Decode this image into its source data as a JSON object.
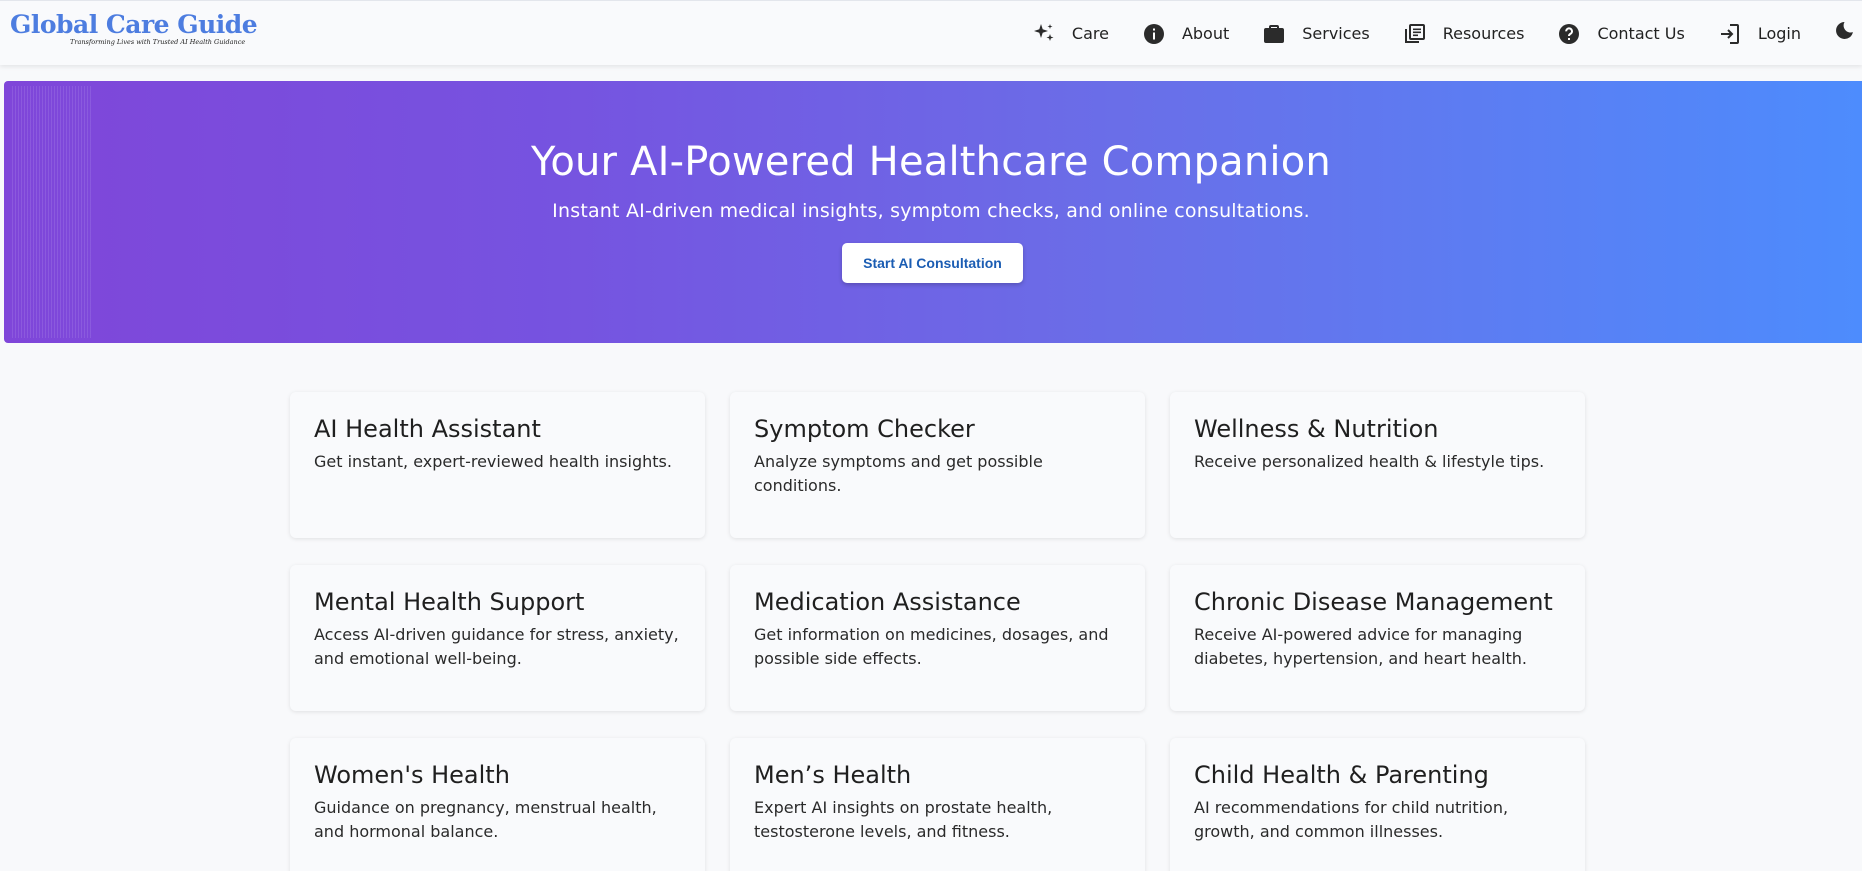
{
  "brand": {
    "name": "Global Care Guide",
    "tagline": "Transforming Lives with Trusted AI Health Guidance",
    "color": "#4d7de0"
  },
  "nav": {
    "items": [
      {
        "label": "Care",
        "icon": "sparkle-icon"
      },
      {
        "label": "About",
        "icon": "info-icon"
      },
      {
        "label": "Services",
        "icon": "briefcase-icon"
      },
      {
        "label": "Resources",
        "icon": "library-books-icon"
      },
      {
        "label": "Contact Us",
        "icon": "help-icon"
      },
      {
        "label": "Login",
        "icon": "login-icon"
      }
    ],
    "theme_toggle_icon": "moon-icon"
  },
  "hero": {
    "title": "Your AI-Powered Healthcare Companion",
    "subtitle": "Instant AI-driven medical insights, symptom checks, and online consultations.",
    "cta_label": "Start AI Consultation",
    "gradient_start": "#7f46d9",
    "gradient_end": "#4d8cfd"
  },
  "cards": [
    {
      "title": "AI Health Assistant",
      "description": "Get instant, expert-reviewed health insights."
    },
    {
      "title": "Symptom Checker",
      "description": "Analyze symptoms and get possible conditions."
    },
    {
      "title": "Wellness & Nutrition",
      "description": "Receive personalized health & lifestyle tips."
    },
    {
      "title": "Mental Health Support",
      "description": "Access AI-driven guidance for stress, anxiety, and emotional well-being."
    },
    {
      "title": "Medication Assistance",
      "description": "Get information on medicines, dosages, and possible side effects."
    },
    {
      "title": "Chronic Disease Management",
      "description": "Receive AI-powered advice for managing diabetes, hypertension, and heart health."
    },
    {
      "title": "Women's Health",
      "description": "Guidance on pregnancy, menstrual health, and hormonal balance."
    },
    {
      "title": "Men’s Health",
      "description": "Expert AI insights on prostate health, testosterone levels, and fitness."
    },
    {
      "title": "Child Health & Parenting",
      "description": "AI recommendations for child nutrition, growth, and common illnesses."
    }
  ]
}
